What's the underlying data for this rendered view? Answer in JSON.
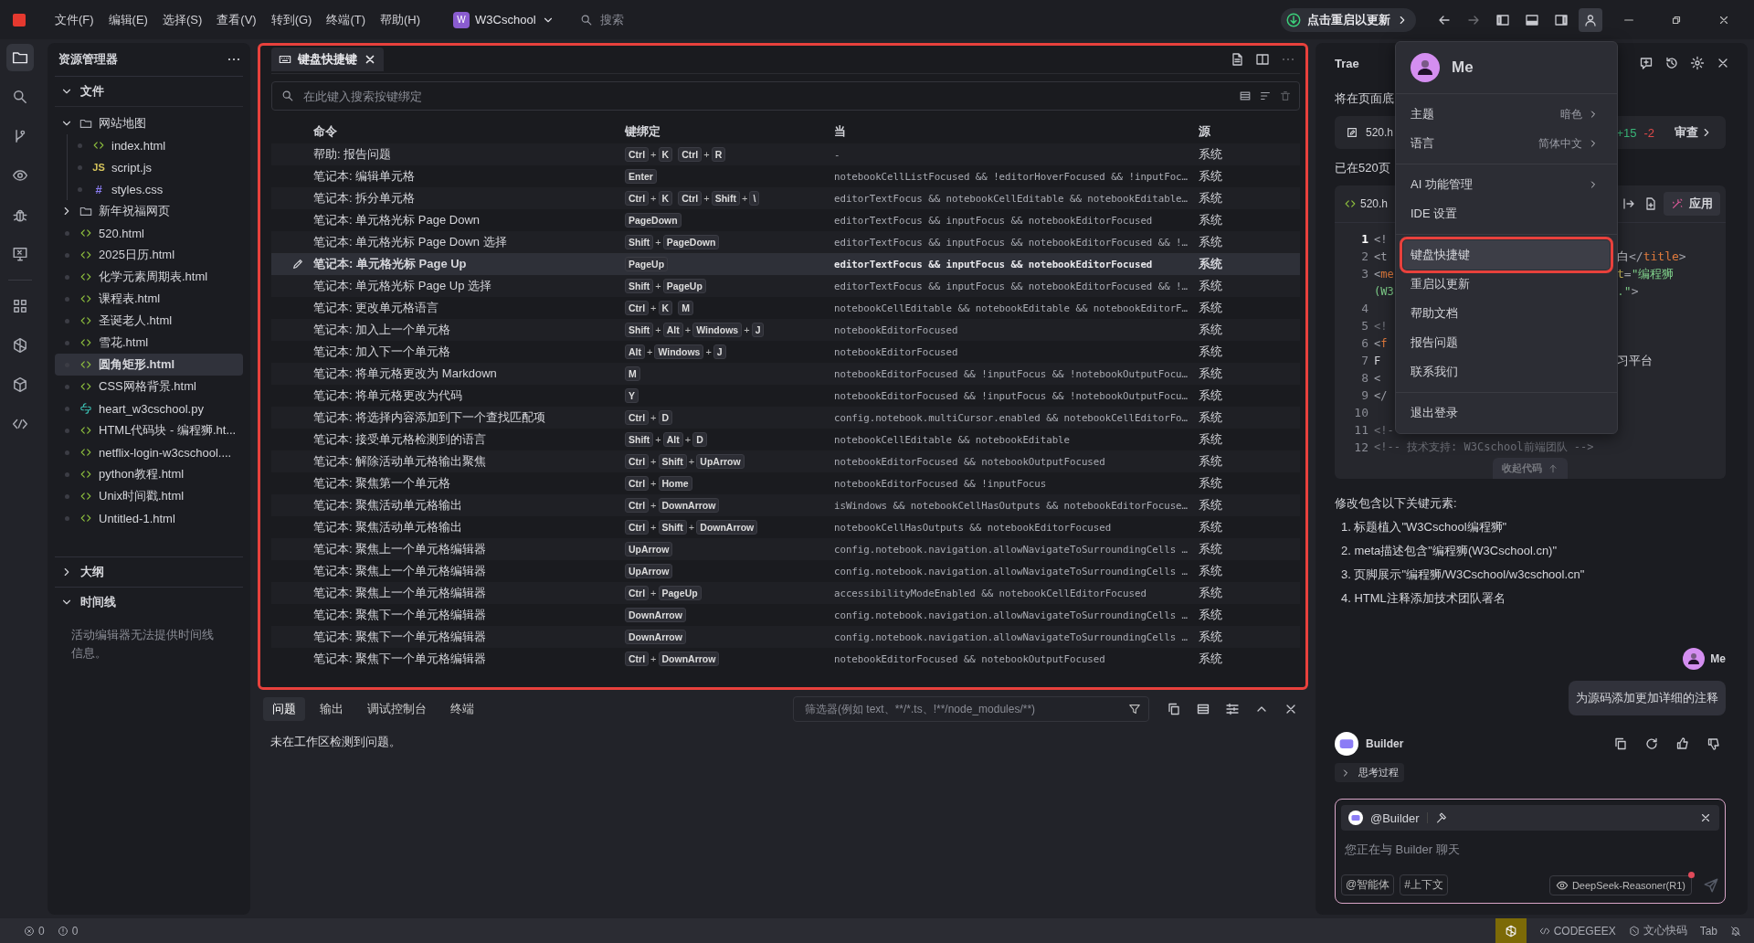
{
  "title_bar": {
    "menus": [
      "文件(F)",
      "编辑(E)",
      "选择(S)",
      "查看(V)",
      "转到(G)",
      "终端(T)",
      "帮助(H)"
    ],
    "project": {
      "badge": "W",
      "name": "W3Cschool"
    },
    "search": {
      "placeholder": "搜索"
    },
    "update": "点击重启以更新",
    "account_selected": true
  },
  "activity_bar": [
    {
      "kind": "files",
      "selected": true
    },
    {
      "kind": "search",
      "selected": false
    },
    {
      "kind": "branch",
      "selected": false
    },
    {
      "kind": "eye",
      "selected": false
    },
    {
      "kind": "bug",
      "selected": false
    },
    {
      "kind": "monitor",
      "selected": false
    },
    {
      "kind": "grid",
      "selected": false
    },
    {
      "kind": "gem",
      "selected": false
    },
    {
      "kind": "cube",
      "selected": false
    },
    {
      "kind": "codelink",
      "selected": false
    }
  ],
  "sidebar": {
    "title": "资源管理器",
    "sections": [
      {
        "kind": "tree",
        "title": "文件",
        "expanded": true,
        "items": [
          {
            "kind": "folder",
            "name": "网站地图",
            "expanded": true,
            "selected": false,
            "children": [
              {
                "kind": "html",
                "name": "index.html",
                "selected": false
              },
              {
                "kind": "js",
                "glyph": "JS",
                "name": "script.js",
                "selected": false
              },
              {
                "kind": "css",
                "glyph": "#",
                "name": "styles.css",
                "selected": false
              }
            ]
          },
          {
            "kind": "folder",
            "name": "新年祝福网页",
            "expanded": false,
            "selected": false
          },
          {
            "kind": "html",
            "name": "520.html",
            "selected": false
          },
          {
            "kind": "html",
            "name": "2025日历.html",
            "selected": false
          },
          {
            "kind": "html",
            "name": "化学元素周期表.html",
            "selected": false
          },
          {
            "kind": "html",
            "name": "课程表.html",
            "selected": false
          },
          {
            "kind": "html",
            "name": "圣诞老人.html",
            "selected": false
          },
          {
            "kind": "html",
            "name": "雪花.html",
            "selected": false
          },
          {
            "kind": "html",
            "name": "圆角矩形.html",
            "selected": true
          },
          {
            "kind": "html",
            "name": "CSS网格背景.html",
            "selected": false
          },
          {
            "kind": "py",
            "name": "heart_w3cschool.py",
            "selected": false
          },
          {
            "kind": "html",
            "name": "HTML代码块 - 编程狮.ht...",
            "selected": false
          },
          {
            "kind": "html",
            "name": "netflix-login-w3cschool....",
            "selected": false
          },
          {
            "kind": "html",
            "name": "python教程.html",
            "selected": false
          },
          {
            "kind": "html",
            "name": "Unix时间戳.html",
            "selected": false
          },
          {
            "kind": "html",
            "name": "Untitled-1.html",
            "selected": false
          }
        ]
      },
      {
        "kind": "plain",
        "title": "大纲",
        "expanded": false
      },
      {
        "kind": "plain",
        "title": "时间线",
        "expanded": true,
        "message": "活动编辑器无法提供时间线信息。"
      }
    ]
  },
  "editor": {
    "highlighted": true,
    "tab": {
      "label": "键盘快捷键",
      "selected": true
    },
    "search": {
      "placeholder": "在此键入搜索按键绑定"
    },
    "columns": [
      "命令",
      "键绑定",
      "当",
      "源"
    ],
    "rows": [
      {
        "command": "帮助: 报告问题",
        "keys": [
          [
            "Ctrl",
            "+",
            "K"
          ],
          [
            "Ctrl",
            "+",
            "R"
          ]
        ],
        "when": "-",
        "source": "系统",
        "selected": false
      },
      {
        "command": "笔记本: 编辑单元格",
        "keys": [
          [
            "Enter"
          ]
        ],
        "when": "notebookCellListFocused && !editorHoverFocused && !inputFoc…",
        "source": "系统",
        "selected": false
      },
      {
        "command": "笔记本: 拆分单元格",
        "keys": [
          [
            "Ctrl",
            "+",
            "K"
          ],
          [
            "Ctrl",
            "+",
            "Shift",
            "+",
            "\\"
          ]
        ],
        "when": "editorTextFocus && notebookCellEditable && notebookEditable…",
        "source": "系统",
        "selected": false
      },
      {
        "command": "笔记本: 单元格光标 Page Down",
        "keys": [
          [
            "PageDown"
          ]
        ],
        "when": "editorTextFocus && inputFocus && notebookEditorFocused",
        "source": "系统",
        "selected": false
      },
      {
        "command": "笔记本: 单元格光标 Page Down 选择",
        "keys": [
          [
            "Shift",
            "+",
            "PageDown"
          ]
        ],
        "when": "editorTextFocus && inputFocus && notebookEditorFocused && !…",
        "source": "系统",
        "selected": false
      },
      {
        "command": "笔记本: 单元格光标 Page Up",
        "keys": [
          [
            "PageUp"
          ]
        ],
        "when": "editorTextFocus && inputFocus && notebookEditorFocused",
        "source": "系统",
        "selected": true
      },
      {
        "command": "笔记本: 单元格光标 Page Up 选择",
        "keys": [
          [
            "Shift",
            "+",
            "PageUp"
          ]
        ],
        "when": "editorTextFocus && inputFocus && notebookEditorFocused && !…",
        "source": "系统",
        "selected": false
      },
      {
        "command": "笔记本: 更改单元格语言",
        "keys": [
          [
            "Ctrl",
            "+",
            "K"
          ],
          [
            "M"
          ]
        ],
        "when": "notebookCellEditable && notebookEditable && notebookEditorF…",
        "source": "系统",
        "selected": false
      },
      {
        "command": "笔记本: 加入上一个单元格",
        "keys": [
          [
            "Shift",
            "+",
            "Alt",
            "+",
            "Windows",
            "+",
            "J"
          ]
        ],
        "when": "notebookEditorFocused",
        "source": "系统",
        "selected": false
      },
      {
        "command": "笔记本: 加入下一个单元格",
        "keys": [
          [
            "Alt",
            "+",
            "Windows",
            "+",
            "J"
          ]
        ],
        "when": "notebookEditorFocused",
        "source": "系统",
        "selected": false
      },
      {
        "command": "笔记本: 将单元格更改为 Markdown",
        "keys": [
          [
            "M"
          ]
        ],
        "when": "notebookEditorFocused && !inputFocus && !notebookOutputFocu…",
        "source": "系统",
        "selected": false
      },
      {
        "command": "笔记本: 将单元格更改为代码",
        "keys": [
          [
            "Y"
          ]
        ],
        "when": "notebookEditorFocused && !inputFocus && !notebookOutputFocu…",
        "source": "系统",
        "selected": false
      },
      {
        "command": "笔记本: 将选择内容添加到下一个查找匹配项",
        "keys": [
          [
            "Ctrl",
            "+",
            "D"
          ]
        ],
        "when": "config.notebook.multiCursor.enabled && notebookCellEditorFo…",
        "source": "系统",
        "selected": false
      },
      {
        "command": "笔记本: 接受单元格检测到的语言",
        "keys": [
          [
            "Shift",
            "+",
            "Alt",
            "+",
            "D"
          ]
        ],
        "when": "notebookCellEditable && notebookEditable",
        "source": "系统",
        "selected": false
      },
      {
        "command": "笔记本: 解除活动单元格输出聚焦",
        "keys": [
          [
            "Ctrl",
            "+",
            "Shift",
            "+",
            "UpArrow"
          ]
        ],
        "when": "notebookEditorFocused && notebookOutputFocused",
        "source": "系统",
        "selected": false
      },
      {
        "command": "笔记本: 聚焦第一个单元格",
        "keys": [
          [
            "Ctrl",
            "+",
            "Home"
          ]
        ],
        "when": "notebookEditorFocused && !inputFocus",
        "source": "系统",
        "selected": false
      },
      {
        "command": "笔记本: 聚焦活动单元格输出",
        "keys": [
          [
            "Ctrl",
            "+",
            "DownArrow"
          ]
        ],
        "when": "isWindows && notebookCellHasOutputs && notebookEditorFocuse…",
        "source": "系统",
        "selected": false
      },
      {
        "command": "笔记本: 聚焦活动单元格输出",
        "keys": [
          [
            "Ctrl",
            "+",
            "Shift",
            "+",
            "DownArrow"
          ]
        ],
        "when": "notebookCellHasOutputs && notebookEditorFocused",
        "source": "系统",
        "selected": false
      },
      {
        "command": "笔记本: 聚焦上一个单元格编辑器",
        "keys": [
          [
            "UpArrow"
          ]
        ],
        "when": "config.notebook.navigation.allowNavigateToSurroundingCells …",
        "source": "系统",
        "selected": false
      },
      {
        "command": "笔记本: 聚焦上一个单元格编辑器",
        "keys": [
          [
            "UpArrow"
          ]
        ],
        "when": "config.notebook.navigation.allowNavigateToSurroundingCells …",
        "source": "系统",
        "selected": false
      },
      {
        "command": "笔记本: 聚焦上一个单元格编辑器",
        "keys": [
          [
            "Ctrl",
            "+",
            "PageUp"
          ]
        ],
        "when": "accessibilityModeEnabled && notebookCellEditorFocused",
        "source": "系统",
        "selected": false
      },
      {
        "command": "笔记本: 聚焦下一个单元格编辑器",
        "keys": [
          [
            "DownArrow"
          ]
        ],
        "when": "config.notebook.navigation.allowNavigateToSurroundingCells …",
        "source": "系统",
        "selected": false
      },
      {
        "command": "笔记本: 聚焦下一个单元格编辑器",
        "keys": [
          [
            "DownArrow"
          ]
        ],
        "when": "config.notebook.navigation.allowNavigateToSurroundingCells …",
        "source": "系统",
        "selected": false
      },
      {
        "command": "笔记本: 聚焦下一个单元格编辑器",
        "keys": [
          [
            "Ctrl",
            "+",
            "DownArrow"
          ]
        ],
        "when": "notebookEditorFocused && notebookOutputFocused",
        "source": "系统",
        "selected": false
      }
    ]
  },
  "panel": {
    "tabs": [
      {
        "label": "问题",
        "selected": true
      },
      {
        "label": "输出",
        "selected": false
      },
      {
        "label": "调试控制台",
        "selected": false
      },
      {
        "label": "终端",
        "selected": false
      }
    ],
    "filter": {
      "placeholder": "筛选器(例如 text、**/*.ts、!**/node_modules/**)"
    },
    "message": "未在工作区检测到问题。"
  },
  "chat": {
    "title": "Trae",
    "intro": "将在页面底",
    "file_card": {
      "name": "520.h",
      "added": "+15",
      "removed": "-2",
      "action": "审查"
    },
    "done": "已在520页",
    "code_card": {
      "name": "520.h",
      "apply": "应用",
      "collapse": "收起代码",
      "lines": [
        {
          "number": "1",
          "current": true,
          "left": [
            {
              "kind": "punct",
              "text": "<!"
            }
          ]
        },
        {
          "number": "2",
          "current": false,
          "left": [
            {
              "kind": "punct",
              "text": "<t"
            }
          ],
          "right": [
            {
              "kind": "plain",
              "text": "白"
            },
            {
              "kind": "punct",
              "text": "</"
            },
            {
              "kind": "tag",
              "text": "title"
            },
            {
              "kind": "punct",
              "text": ">"
            }
          ]
        },
        {
          "number": "3",
          "current": false,
          "left": [
            {
              "kind": "punct",
              "text": "<"
            },
            {
              "kind": "tag",
              "text": "me"
            }
          ],
          "right": [
            {
              "kind": "attr",
              "text": "t"
            },
            {
              "kind": "punct",
              "text": "="
            },
            {
              "kind": "string",
              "text": "\"编程狮"
            }
          ]
        },
        {
          "left": [
            {
              "kind": "string",
              "text": "(W3"
            }
          ],
          "right": [
            {
              "kind": "string",
              "text": ".\""
            },
            {
              "kind": "punct",
              "text": ">"
            }
          ]
        },
        {
          "number": "4",
          "current": false
        },
        {
          "number": "5",
          "current": false,
          "left": [
            {
              "kind": "comment",
              "text": "<!"
            }
          ]
        },
        {
          "number": "6",
          "current": false,
          "left": [
            {
              "kind": "punct",
              "text": "<"
            },
            {
              "kind": "tag",
              "text": "f"
            }
          ]
        },
        {
          "number": "7",
          "current": false,
          "left": [
            {
              "kind": "plain",
              "text": "F"
            }
          ],
          "right": [
            {
              "kind": "plain",
              "text": "习平台"
            }
          ]
        },
        {
          "number": "8",
          "current": false,
          "left": [
            {
              "kind": "punct",
              "text": "<"
            }
          ]
        },
        {
          "number": "9",
          "current": false,
          "left": [
            {
              "kind": "punct",
              "text": "</"
            }
          ]
        },
        {
          "number": "10",
          "current": false
        },
        {
          "number": "11",
          "current": false,
          "left": [
            {
              "kind": "comment",
              "text": "<!-"
            }
          ]
        },
        {
          "number": "12",
          "current": false,
          "left": [
            {
              "kind": "comment",
              "text": "<!-- 技术支持: W3Cschool前端团队 -->"
            }
          ]
        }
      ]
    },
    "summary": "修改包含以下关键元素:",
    "points": [
      "1. 标题植入\"W3Cschool编程狮\"",
      "2. meta描述包含\"编程狮(W3Cschool.cn)\"",
      "3. 页脚展示\"编程狮/W3Cschool/w3cschool.cn\"",
      "4. HTML注释添加技术团队署名"
    ],
    "user": {
      "name": "Me",
      "message": "为源码添加更加详细的注释"
    },
    "bot": {
      "name": "Builder",
      "thinking": {
        "label": "思考过程",
        "expanded": false
      }
    },
    "input": {
      "agent": "@Builder",
      "placeholder": "您正在与 Builder 聊天",
      "buttons": [
        "@智能体",
        "#上下文"
      ],
      "model": "DeepSeek-Reasoner(R1)",
      "model_alert": true
    }
  },
  "menu": {
    "name": "Me",
    "groups": [
      [
        {
          "label": "主题",
          "value": "暗色",
          "submenu": true,
          "selected": false
        },
        {
          "label": "语言",
          "value": "简体中文",
          "submenu": true,
          "selected": false
        }
      ],
      [
        {
          "label": "AI 功能管理",
          "submenu": true,
          "selected": false
        },
        {
          "label": "IDE 设置",
          "submenu": false,
          "selected": false
        }
      ],
      [
        {
          "label": "键盘快捷键",
          "submenu": false,
          "selected": true,
          "highlighted": true
        },
        {
          "label": "重启以更新",
          "submenu": false,
          "selected": false
        },
        {
          "label": "帮助文档",
          "submenu": false,
          "selected": false
        },
        {
          "label": "报告问题",
          "submenu": false,
          "selected": false
        },
        {
          "label": "联系我们",
          "submenu": false,
          "selected": false
        }
      ],
      [
        {
          "label": "退出登录",
          "submenu": false,
          "selected": false
        }
      ]
    ]
  },
  "status_bar": {
    "errors": "0",
    "warnings": "0",
    "items": [
      "CODEGEEX",
      "文心快码",
      "Tab"
    ]
  }
}
